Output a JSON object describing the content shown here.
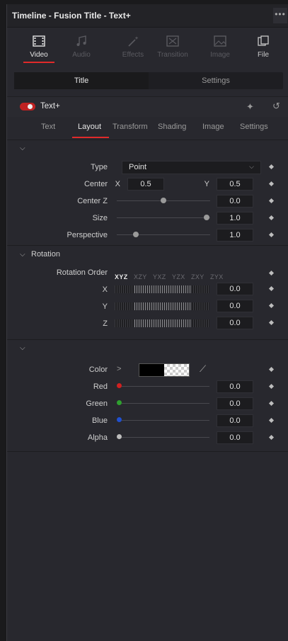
{
  "window": {
    "title": "Timeline - Fusion Title - Text+",
    "more": "•••"
  },
  "tabs": [
    {
      "label": "Video",
      "icon": "film-icon",
      "active": true
    },
    {
      "label": "Audio",
      "icon": "music-note-icon",
      "active": false
    },
    {
      "label": "Effects",
      "icon": "magic-wand-icon",
      "active": false
    },
    {
      "label": "Transition",
      "icon": "transition-icon",
      "active": false
    },
    {
      "label": "Image",
      "icon": "image-icon",
      "active": false
    },
    {
      "label": "File",
      "icon": "file-icon",
      "active": false
    }
  ],
  "segments": {
    "title": "Title",
    "settings": "Settings"
  },
  "tool": {
    "name": "Text+",
    "enabled": true
  },
  "subtabs": [
    "Text",
    "Layout",
    "Transform",
    "Shading",
    "Image",
    "Settings"
  ],
  "layout": {
    "type_label": "Type",
    "type_value": "Point",
    "center_label": "Center",
    "x_label": "X",
    "center_x": "0.5",
    "y_label": "Y",
    "center_y": "0.5",
    "centerz_label": "Center Z",
    "centerz_value": "0.0",
    "size_label": "Size",
    "size_value": "1.0",
    "perspective_label": "Perspective",
    "perspective_value": "1.0"
  },
  "rotation": {
    "title": "Rotation",
    "order_label": "Rotation Order",
    "orders": [
      "XYZ",
      "XZY",
      "YXZ",
      "YZX",
      "ZXY",
      "ZYX"
    ],
    "x_label": "X",
    "x_value": "0.0",
    "y_label": "Y",
    "y_value": "0.0",
    "z_label": "Z",
    "z_value": "0.0"
  },
  "color": {
    "color_label": "Color",
    "expand": ">",
    "red_label": "Red",
    "red_value": "0.0",
    "green_label": "Green",
    "green_value": "0.0",
    "blue_label": "Blue",
    "blue_value": "0.0",
    "alpha_label": "Alpha",
    "alpha_value": "0.0",
    "red_hex": "#d02020",
    "green_hex": "#2fa02f",
    "blue_hex": "#2050d0",
    "alpha_hex": "#bdbdbd"
  }
}
